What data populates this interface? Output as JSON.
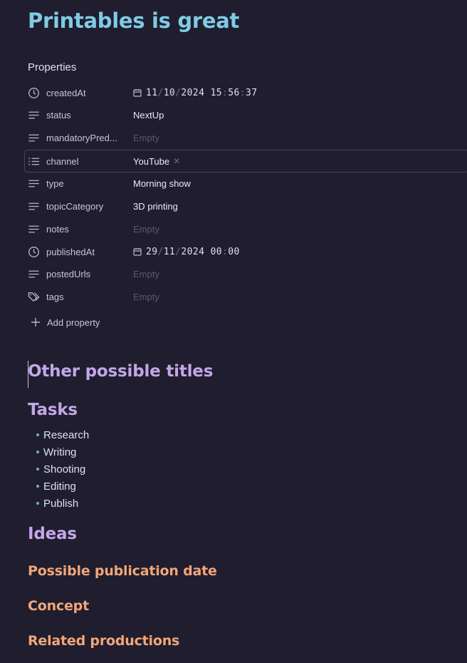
{
  "title": "Printables is great",
  "properties": {
    "heading": "Properties",
    "rows": [
      {
        "key": "createdAt",
        "icon": "clock-icon",
        "type": "date",
        "date": {
          "d": "11",
          "m": "10",
          "y": "2024",
          "h": "15",
          "mi": "56",
          "s": "37"
        }
      },
      {
        "key": "status",
        "icon": "text-lines-icon",
        "value": "NextUp"
      },
      {
        "key": "mandatoryPred...",
        "icon": "text-lines-icon",
        "value": "Empty",
        "empty": true
      },
      {
        "key": "channel",
        "icon": "list-icon",
        "value": "YouTube",
        "removable": true
      },
      {
        "key": "type",
        "icon": "text-lines-icon",
        "value": "Morning show"
      },
      {
        "key": "topicCategory",
        "icon": "text-lines-icon",
        "value": "3D printing"
      },
      {
        "key": "notes",
        "icon": "text-lines-icon",
        "value": "Empty",
        "empty": true
      },
      {
        "key": "publishedAt",
        "icon": "clock-icon",
        "type": "date",
        "date": {
          "d": "29",
          "m": "11",
          "y": "2024",
          "h": "00",
          "mi": "00"
        }
      },
      {
        "key": "postedUrls",
        "icon": "text-lines-icon",
        "value": "Empty",
        "empty": true
      },
      {
        "key": "tags",
        "icon": "tag-icon",
        "value": "Empty",
        "empty": true
      }
    ],
    "add_label": "Add property"
  },
  "headings": {
    "other_titles": "Other possible titles",
    "tasks": "Tasks",
    "ideas": "Ideas",
    "pub_date": "Possible publication date",
    "concept": "Concept",
    "related": "Related productions"
  },
  "tasks": [
    "Research",
    "Writing",
    "Shooting",
    "Editing",
    "Publish"
  ],
  "colors": {
    "background": "#1f1d2e",
    "title": "#7fcbe3",
    "h2": "#c4a7e7",
    "h3": "#f2a679"
  }
}
